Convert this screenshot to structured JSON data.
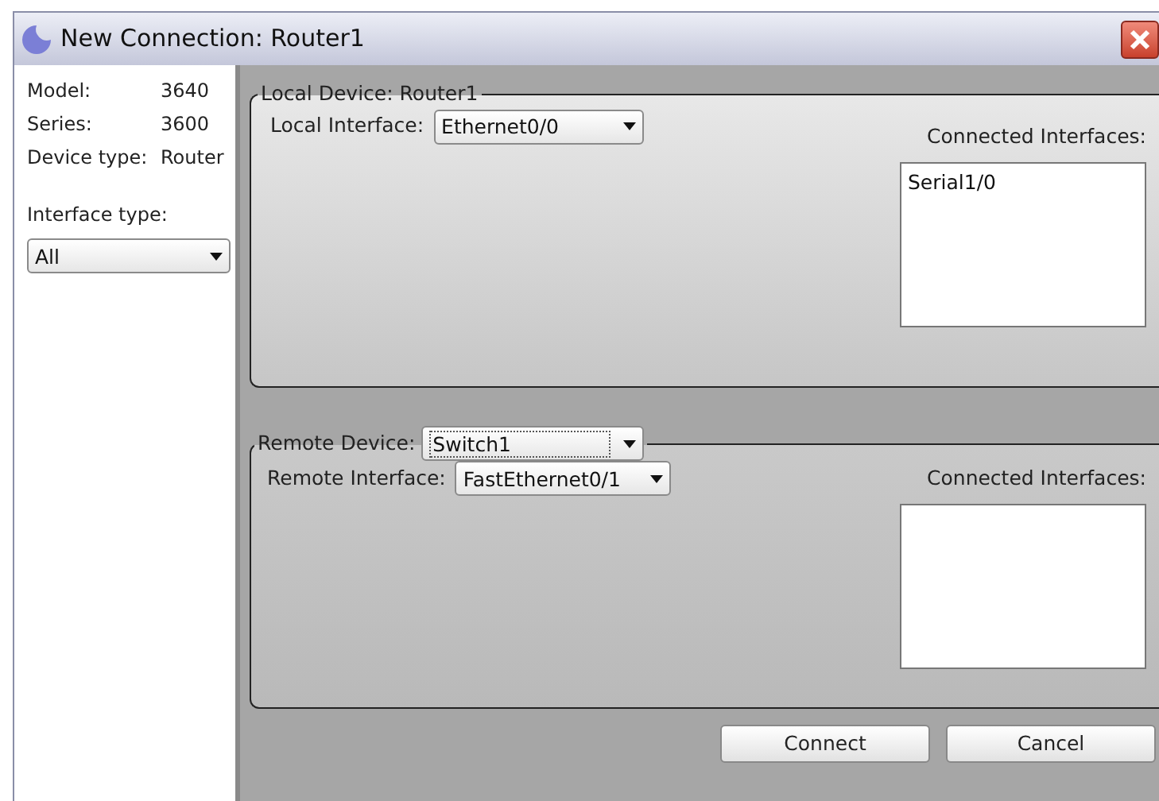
{
  "window": {
    "title": "New Connection: Router1"
  },
  "device_info": [
    {
      "label": "Model:",
      "value": "3640"
    },
    {
      "label": "Series:",
      "value": "3600"
    },
    {
      "label": "Device type:",
      "value": "Router"
    }
  ],
  "interface_type": {
    "label": "Interface type:",
    "value": "All"
  },
  "local_device": {
    "title": "Local Device: Router1",
    "interface_label": "Local Interface:",
    "interface_value": "Ethernet0/0",
    "connected_label": "Connected Interfaces:",
    "connected": [
      "Serial1/0"
    ]
  },
  "remote_device": {
    "title_label": "Remote Device:",
    "device_value": "Switch1",
    "interface_label": "Remote Interface:",
    "interface_value": "FastEthernet0/1",
    "connected_label": "Connected Interfaces:"
  },
  "buttons": [
    "Connect",
    "Cancel"
  ]
}
